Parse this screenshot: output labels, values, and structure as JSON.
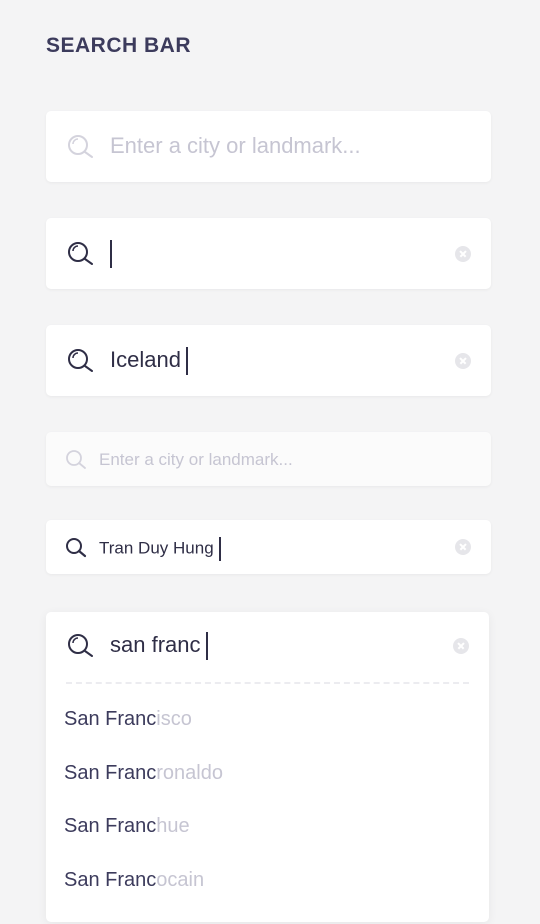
{
  "title": "SEARCH BAR",
  "icons": {
    "search": "search-icon",
    "clear": "clear-icon"
  },
  "colors": {
    "background": "#f4f4f5",
    "text": "#2f2e46",
    "heading": "#3c3b5c",
    "placeholder": "#c6c5d2",
    "clear_button": "#e6e6ea"
  },
  "bars": [
    {
      "state": "empty",
      "placeholder": "Enter a city or landmark..."
    },
    {
      "state": "focused",
      "value": ""
    },
    {
      "state": "typing",
      "value": "Iceland"
    },
    {
      "state": "empty-compact",
      "placeholder": "Enter a city or landmark..."
    },
    {
      "state": "typing-compact",
      "value": "Tran Duy Hung"
    }
  ],
  "autocomplete": {
    "value": "san franc",
    "suggestions": [
      {
        "match": "San Franc",
        "rest": "isco"
      },
      {
        "match": "San Franc",
        "rest": "ronaldo"
      },
      {
        "match": "San Franc",
        "rest": "hue"
      },
      {
        "match": "San Franc",
        "rest": "ocain"
      }
    ]
  }
}
